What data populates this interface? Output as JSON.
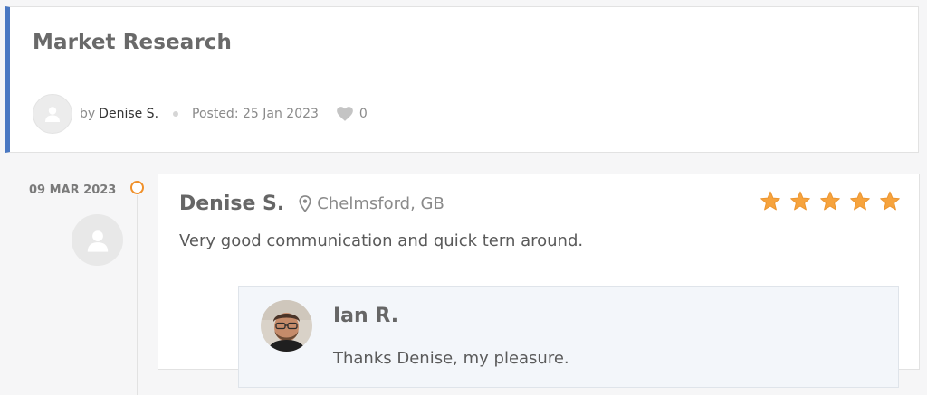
{
  "project": {
    "title": "Market Research",
    "by_label": "by",
    "author": "Denise S.",
    "posted": "Posted: 25 Jan 2023",
    "likes": "0"
  },
  "review": {
    "date": "09 MAR 2023",
    "reviewer": "Denise S.",
    "location": "Chelmsford, GB",
    "rating": 5,
    "rating_max": 5,
    "text": "Very good communication and quick tern around."
  },
  "reply": {
    "name": "Ian R.",
    "text": "Thanks Denise, my pleasure."
  },
  "colors": {
    "accent_bar": "#4a78c2",
    "timeline_dot": "#f0902a",
    "star": "#f6a33d"
  },
  "icons": [
    "user-placeholder-icon",
    "heart-icon",
    "location-pin-icon",
    "star-icon"
  ]
}
